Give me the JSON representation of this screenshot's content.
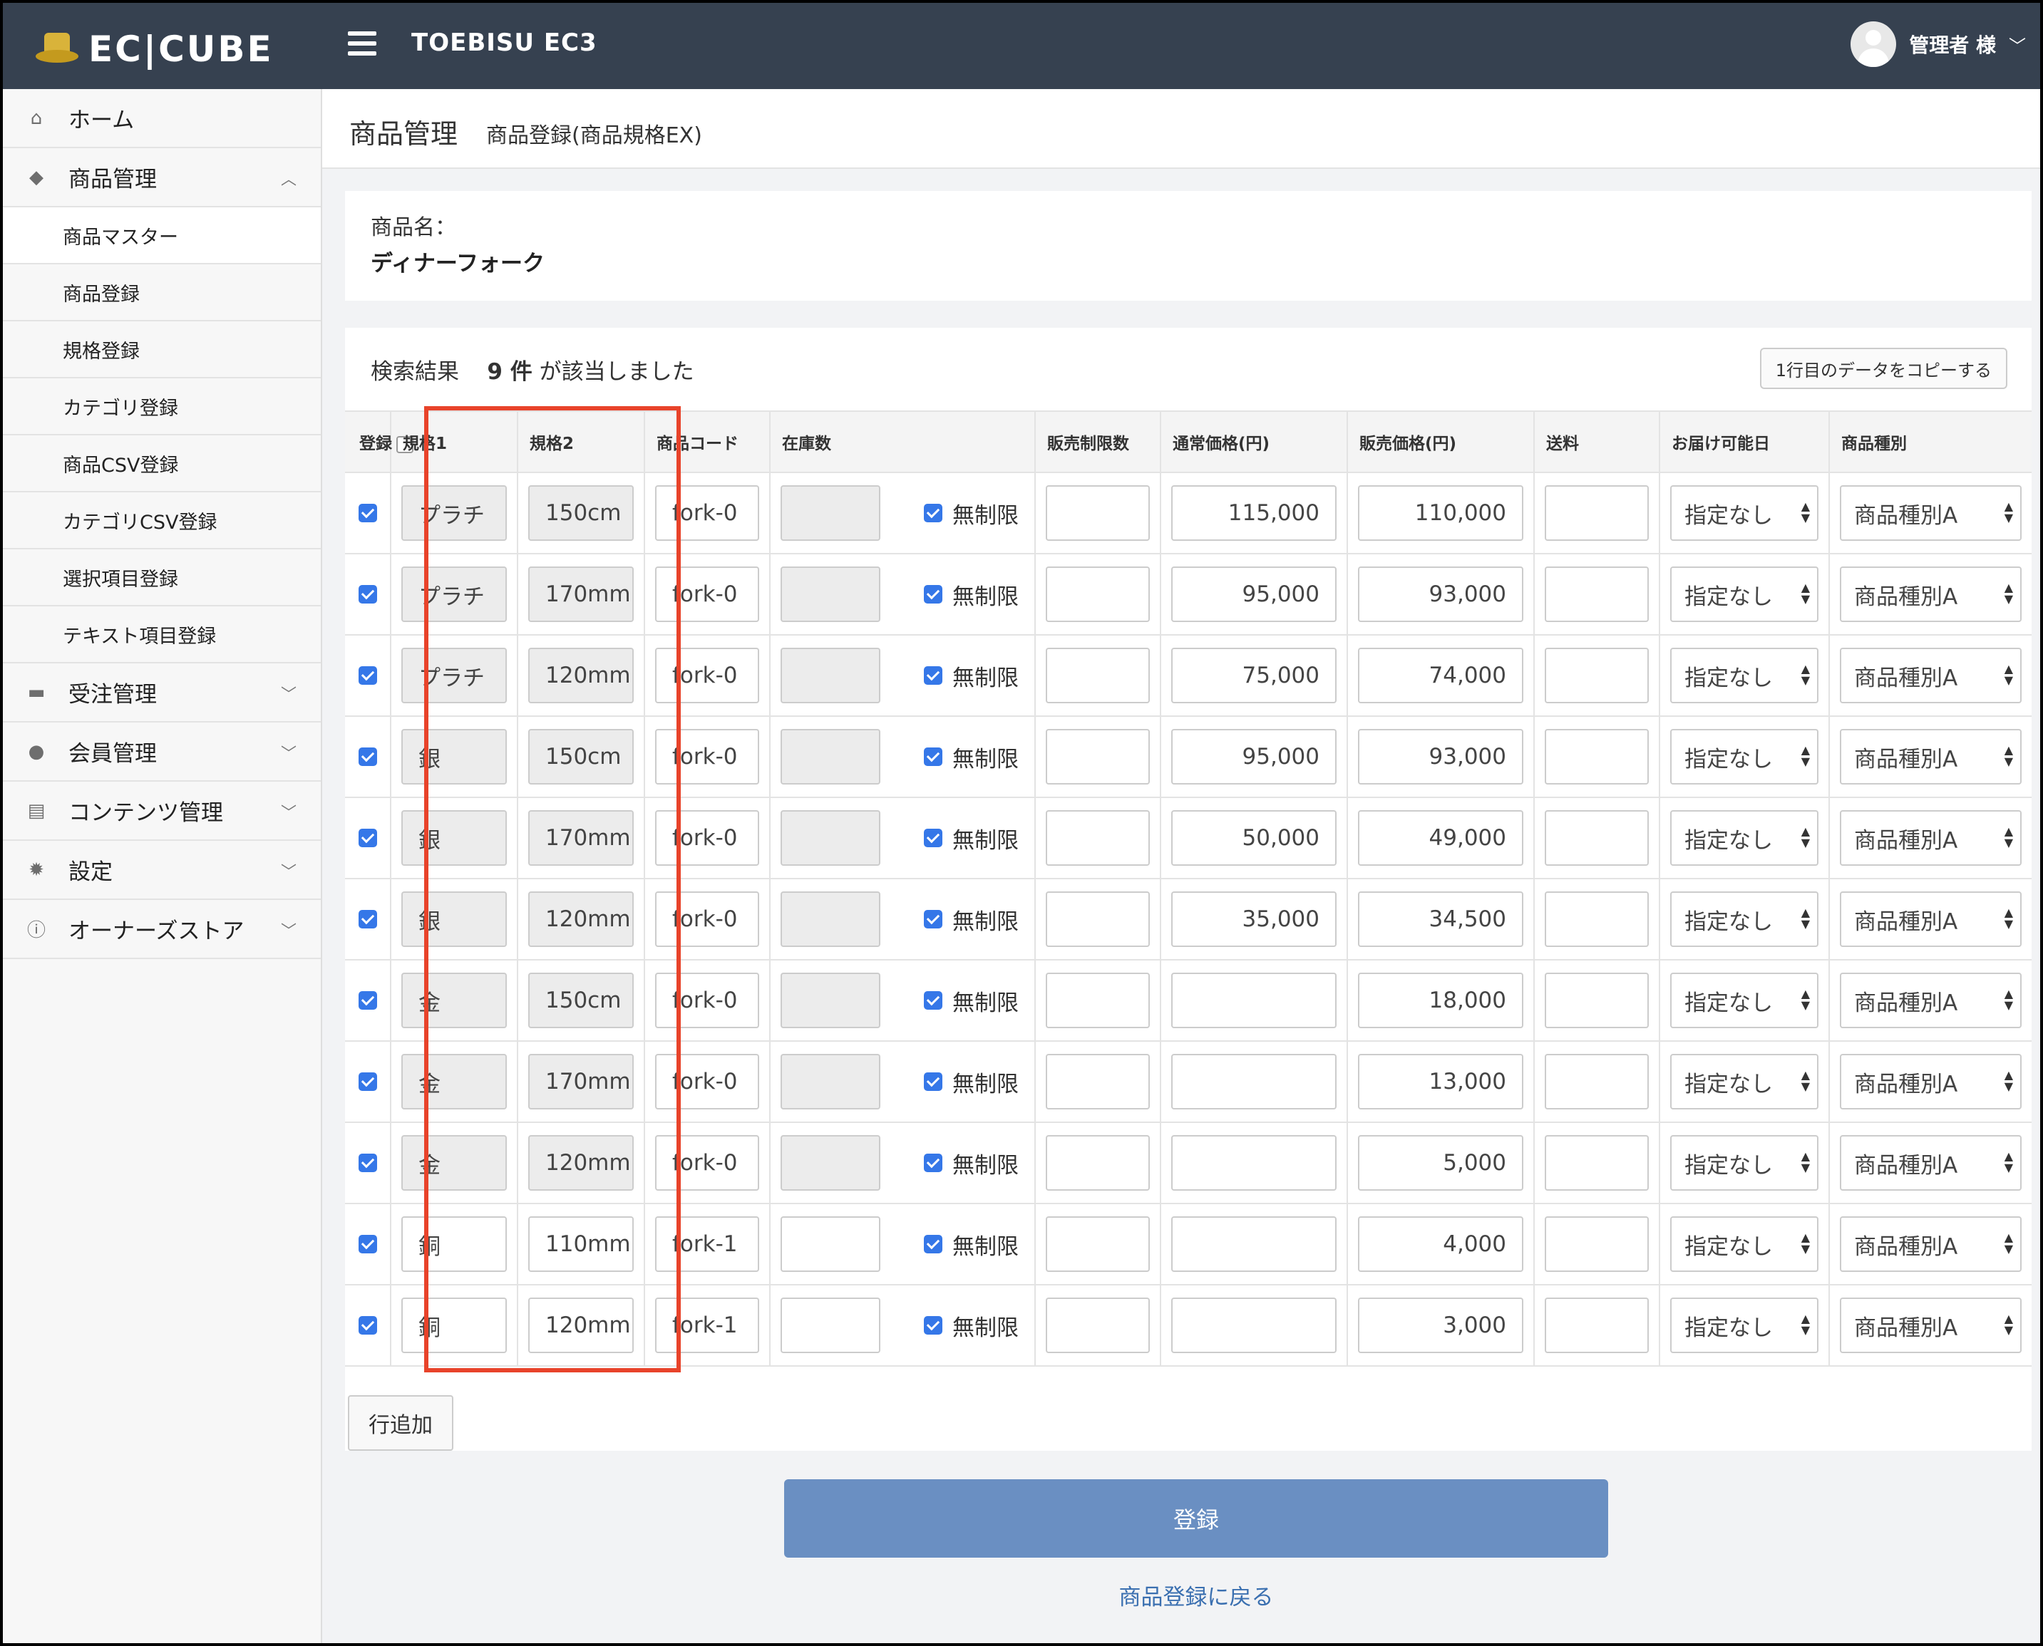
{
  "header": {
    "logo_text": "EC|CUBE",
    "shop_name": "TOEBISU EC3",
    "user_name": "管理者 様",
    "chevron": "﹀"
  },
  "sidebar": {
    "items": [
      {
        "label": "ホーム",
        "icon": "home-icon",
        "glyph": "⌂"
      },
      {
        "label": "商品管理",
        "icon": "tag-icon",
        "glyph": "◆",
        "chevron": "︿"
      },
      {
        "label": "受注管理",
        "icon": "cart-icon",
        "glyph": "▬",
        "chevron": "﹀"
      },
      {
        "label": "会員管理",
        "icon": "users-icon",
        "glyph": "●",
        "chevron": "﹀"
      },
      {
        "label": "コンテンツ管理",
        "icon": "document-icon",
        "glyph": "▤",
        "chevron": "﹀"
      },
      {
        "label": "設定",
        "icon": "gear-icon",
        "glyph": "✹",
        "chevron": "﹀"
      },
      {
        "label": "オーナーズストア",
        "icon": "info-icon",
        "glyph": "ⓘ",
        "chevron": "﹀"
      }
    ],
    "sub_items": [
      "商品マスター",
      "商品登録",
      "規格登録",
      "カテゴリ登録",
      "商品CSV登録",
      "カテゴリCSV登録",
      "選択項目登録",
      "テキスト項目登録"
    ]
  },
  "page": {
    "title": "商品管理",
    "subtitle": "商品登録(商品規格EX)"
  },
  "product": {
    "name_label": "商品名：",
    "name_value": "ディナーフォーク"
  },
  "result": {
    "prefix": "検索結果",
    "count": "9 件",
    "suffix": "が該当しました",
    "copy_button": "1行目のデータをコピーする"
  },
  "table": {
    "headers": [
      "登録",
      "規格1",
      "規格2",
      "商品コード",
      "在庫数",
      "販売制限数",
      "通常価格(円)",
      "販売価格(円)",
      "送料",
      "お届け可能日",
      "商品種別"
    ],
    "unlimited_label": "無制限",
    "rows": [
      {
        "spec1": "プラチ",
        "spec2": "150cm",
        "code": "fork-0",
        "normal_price": "115,000",
        "sale_price": "110,000",
        "delivery": "指定なし",
        "kind": "商品種別A",
        "readonly": true
      },
      {
        "spec1": "プラチ",
        "spec2": "170mm",
        "code": "fork-0",
        "normal_price": "95,000",
        "sale_price": "93,000",
        "delivery": "指定なし",
        "kind": "商品種別A",
        "readonly": true
      },
      {
        "spec1": "プラチ",
        "spec2": "120mm",
        "code": "fork-0",
        "normal_price": "75,000",
        "sale_price": "74,000",
        "delivery": "指定なし",
        "kind": "商品種別A",
        "readonly": true
      },
      {
        "spec1": "銀",
        "spec2": "150cm",
        "code": "fork-0",
        "normal_price": "95,000",
        "sale_price": "93,000",
        "delivery": "指定なし",
        "kind": "商品種別A",
        "readonly": true
      },
      {
        "spec1": "銀",
        "spec2": "170mm",
        "code": "fork-0",
        "normal_price": "50,000",
        "sale_price": "49,000",
        "delivery": "指定なし",
        "kind": "商品種別A",
        "readonly": true
      },
      {
        "spec1": "銀",
        "spec2": "120mm",
        "code": "fork-0",
        "normal_price": "35,000",
        "sale_price": "34,500",
        "delivery": "指定なし",
        "kind": "商品種別A",
        "readonly": true
      },
      {
        "spec1": "金",
        "spec2": "150cm",
        "code": "fork-0",
        "normal_price": "",
        "sale_price": "18,000",
        "delivery": "指定なし",
        "kind": "商品種別A",
        "readonly": true
      },
      {
        "spec1": "金",
        "spec2": "170mm",
        "code": "fork-0",
        "normal_price": "",
        "sale_price": "13,000",
        "delivery": "指定なし",
        "kind": "商品種別A",
        "readonly": true
      },
      {
        "spec1": "金",
        "spec2": "120mm",
        "code": "fork-0",
        "normal_price": "",
        "sale_price": "5,000",
        "delivery": "指定なし",
        "kind": "商品種別A",
        "readonly": true
      },
      {
        "spec1": "銅",
        "spec2": "110mm",
        "code": "fork-1",
        "normal_price": "",
        "sale_price": "4,000",
        "delivery": "指定なし",
        "kind": "商品種別A",
        "readonly": false
      },
      {
        "spec1": "銅",
        "spec2": "120mm",
        "code": "fork-1",
        "normal_price": "",
        "sale_price": "3,000",
        "delivery": "指定なし",
        "kind": "商品種別A",
        "readonly": false
      }
    ]
  },
  "actions": {
    "add_row": "行追加",
    "submit": "登録",
    "back": "商品登録に戻る"
  },
  "colors": {
    "header_bg": "#364150",
    "highlight": "#e8432a",
    "submit_bg": "#6a8fc2",
    "checkbox": "#3577e8"
  }
}
